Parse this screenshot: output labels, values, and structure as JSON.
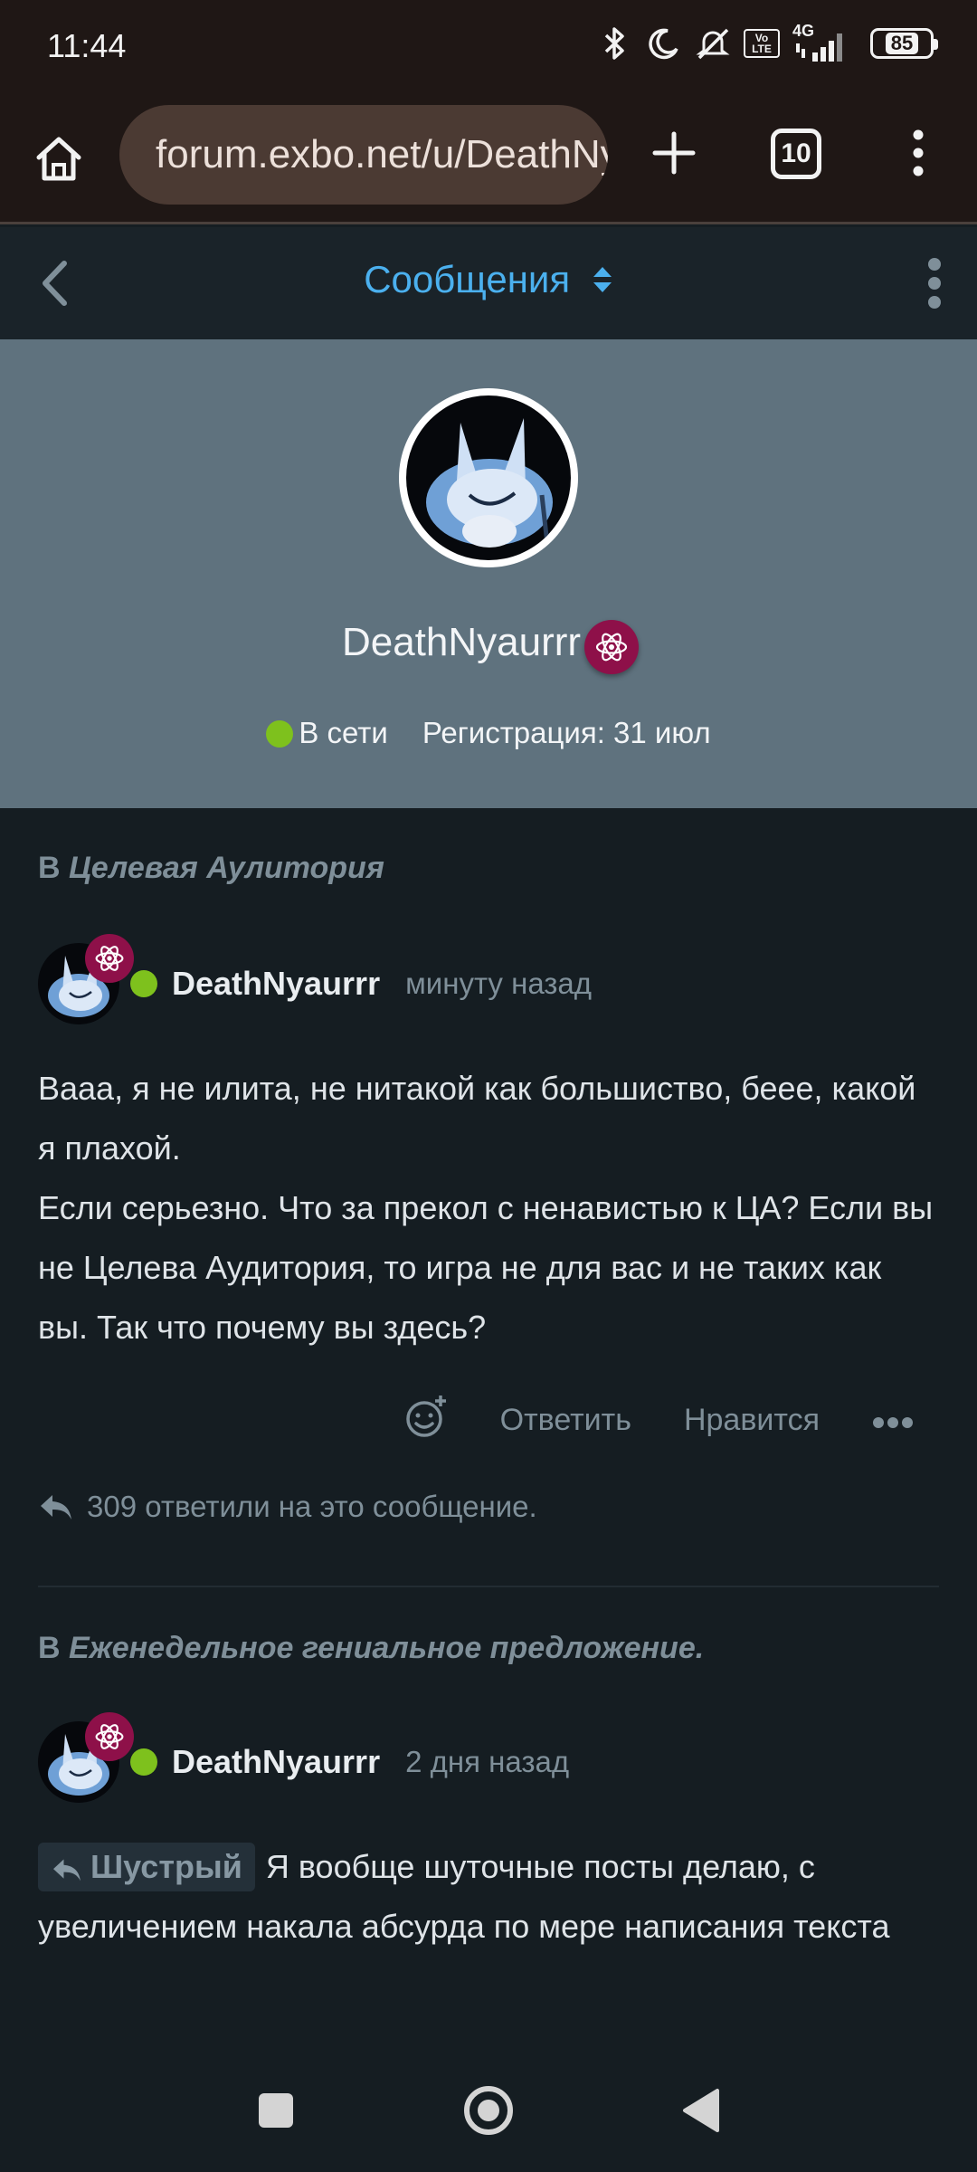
{
  "status_bar": {
    "time": "11:44",
    "network": "4G",
    "volte": "Vo LTE",
    "battery": "85",
    "icons": [
      "bluetooth-icon",
      "moon-icon",
      "mute-icon",
      "volte-icon",
      "signal-icon",
      "battery-icon"
    ]
  },
  "browser": {
    "url": "forum.exbo.net/u/DeathNyaurrr",
    "tab_count": "10",
    "icons": [
      "home-icon",
      "site-settings-icon",
      "plus-icon",
      "tabs-icon",
      "overflow-menu-icon"
    ]
  },
  "forum_header": {
    "title": "Сообщения",
    "accent": "#4bb0ee"
  },
  "profile": {
    "username": "DeathNyaurrr",
    "status": "В сети",
    "registration": "Регистрация: 31 июл",
    "hero_color": "#5f727e",
    "badge_color": "#8e1049",
    "online_color": "#7ec11d"
  },
  "posts": [
    {
      "context_prefix": "В",
      "discussion": "Целевая Аулитория",
      "author": "DeathNyaurrr",
      "time": "минуту назад",
      "body_line1": "Вааа, я не илита, не нитакой как большиство, беее, какой я плахой.",
      "body_line2": "Если серьезно. Что за прекол с ненавистью к ЦА? Если вы не Целева Аудитория, то игра не для вас и не таких как вы. Так что почему вы здесь?",
      "actions": {
        "reply": "Ответить",
        "like": "Нравится"
      },
      "replies": "309 ответили на это сообщение."
    },
    {
      "context_prefix": "В",
      "discussion": "Еженедельное гениальное предложение.",
      "author": "DeathNyaurrr",
      "time": "2 дня назад",
      "mention": "Шустрый",
      "body": "Я вообще шуточные посты делаю, с увеличением накала абсурда по мере написания текста"
    }
  ],
  "nav": {
    "icons": [
      "recents-square-icon",
      "home-circle-icon",
      "back-triangle-icon"
    ]
  }
}
